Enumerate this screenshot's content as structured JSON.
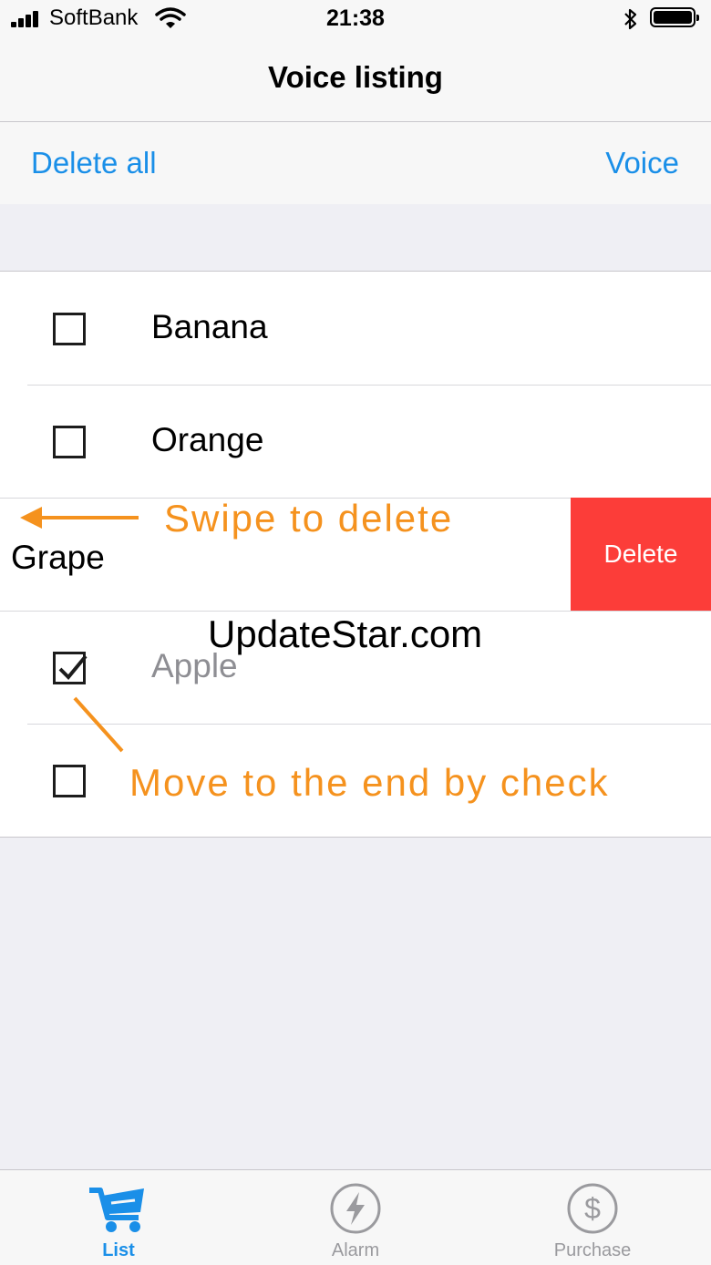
{
  "status": {
    "carrier": "SoftBank",
    "time": "21:38"
  },
  "nav": {
    "title": "Voice listing"
  },
  "toolbar": {
    "left_label": "Delete all",
    "right_label": "Voice"
  },
  "items": [
    {
      "label": "Banana",
      "checked": false
    },
    {
      "label": "Orange",
      "checked": false
    },
    {
      "label": "Grape",
      "swiped": true,
      "action_label": "Delete"
    },
    {
      "label": "Apple",
      "checked": true
    },
    {
      "label": "",
      "checked": false
    }
  ],
  "annotations": {
    "swipe": "Swipe to delete",
    "move": "Move to the end by check",
    "watermark": "UpdateStar.com"
  },
  "tabs": [
    {
      "label": "List",
      "icon": "cart-icon",
      "active": true
    },
    {
      "label": "Alarm",
      "icon": "lightning-icon",
      "active": false
    },
    {
      "label": "Purchase",
      "icon": "dollar-icon",
      "active": false
    }
  ],
  "colors": {
    "accent": "#1a8fe8",
    "delete": "#fc3d39",
    "annotation": "#f5921e"
  }
}
